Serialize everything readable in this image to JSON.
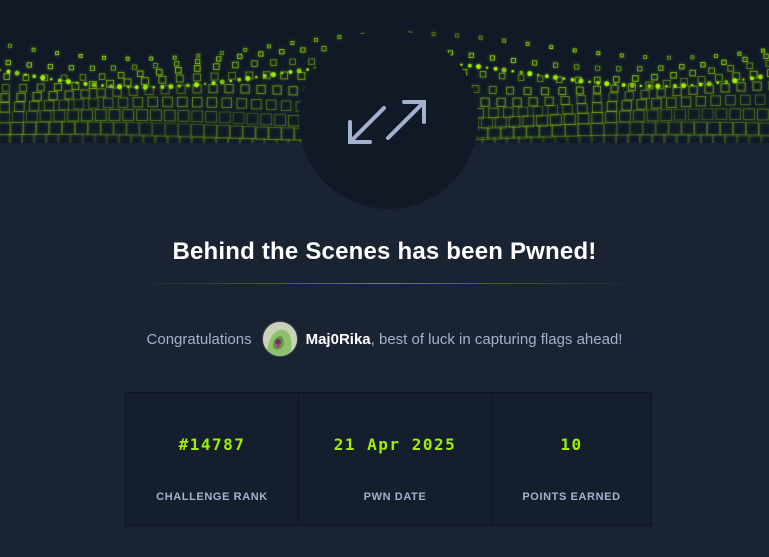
{
  "icons": {
    "badge": "expand-arrows-icon",
    "banner": "hacker-grid-banner"
  },
  "colors": {
    "background": "#1a2332",
    "accent": "#9fef00",
    "text_muted": "#a4b1cd",
    "title": "#ffffff"
  },
  "header": {
    "title": "Behind the Scenes has been Pwned!"
  },
  "congrats": {
    "prefix": "Congratulations",
    "username": "Maj0Rika",
    "suffix": ", best of luck in capturing flags ahead!"
  },
  "stats": [
    {
      "value": "#14787",
      "label": "CHALLENGE RANK"
    },
    {
      "value": "21 Apr 2025",
      "label": "PWN DATE"
    },
    {
      "value": "10",
      "label": "POINTS EARNED"
    }
  ]
}
